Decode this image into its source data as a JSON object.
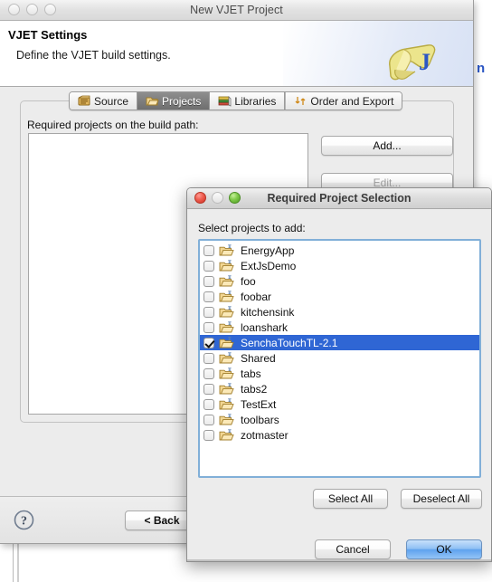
{
  "main_window": {
    "title": "New VJET Project",
    "traffic_lights": [
      "close-inactive",
      "minimize-inactive",
      "zoom-inactive"
    ],
    "header": {
      "title": "VJET Settings",
      "subtitle": "Define the VJET build settings.",
      "logo_icon": "vjet-scroll-j-logo"
    },
    "tabs": [
      {
        "label": "Source",
        "icon": "source-package-icon",
        "selected": false
      },
      {
        "label": "Projects",
        "icon": "open-folder-icon",
        "selected": true
      },
      {
        "label": "Libraries",
        "icon": "books-icon",
        "selected": false
      },
      {
        "label": "Order and Export",
        "icon": "order-arrows-icon",
        "selected": false
      }
    ],
    "group_label": "Required projects on the build path:",
    "side_buttons": [
      {
        "label": "Add...",
        "disabled": false
      },
      {
        "label": "Edit...",
        "disabled": true
      }
    ],
    "footer": {
      "help_icon": "help-question-icon",
      "back_label": "< Back"
    }
  },
  "dialog": {
    "title": "Required Project Selection",
    "traffic_lights": [
      "close-active",
      "minimize-disabled",
      "zoom-active"
    ],
    "prompt": "Select projects to add:",
    "projects": [
      {
        "name": "EnergyApp",
        "checked": false,
        "selected": false
      },
      {
        "name": "ExtJsDemo",
        "checked": false,
        "selected": false
      },
      {
        "name": "foo",
        "checked": false,
        "selected": false
      },
      {
        "name": "foobar",
        "checked": false,
        "selected": false
      },
      {
        "name": "kitchensink",
        "checked": false,
        "selected": false
      },
      {
        "name": "loanshark",
        "checked": false,
        "selected": false
      },
      {
        "name": "SenchaTouchTL-2.1",
        "checked": true,
        "selected": true
      },
      {
        "name": "Shared",
        "checked": false,
        "selected": false
      },
      {
        "name": "tabs",
        "checked": false,
        "selected": false
      },
      {
        "name": "tabs2",
        "checked": false,
        "selected": false
      },
      {
        "name": "TestExt",
        "checked": false,
        "selected": false
      },
      {
        "name": "toolbars",
        "checked": false,
        "selected": false
      },
      {
        "name": "zotmaster",
        "checked": false,
        "selected": false
      }
    ],
    "buttons": {
      "select_all": "Select All",
      "deselect_all": "Deselect All",
      "cancel": "Cancel",
      "ok": "OK"
    },
    "project_icon": "project-folder-icon"
  },
  "background": {
    "clipped_text": "n"
  },
  "colors": {
    "selection_blue": "#2f66d4",
    "focus_ring_blue": "#81afd8",
    "default_button_blue": "#5ea2ee",
    "window_gray": "#ececec",
    "logo_blue": "#2b56c4",
    "logo_yellow": "#e8e08a"
  }
}
